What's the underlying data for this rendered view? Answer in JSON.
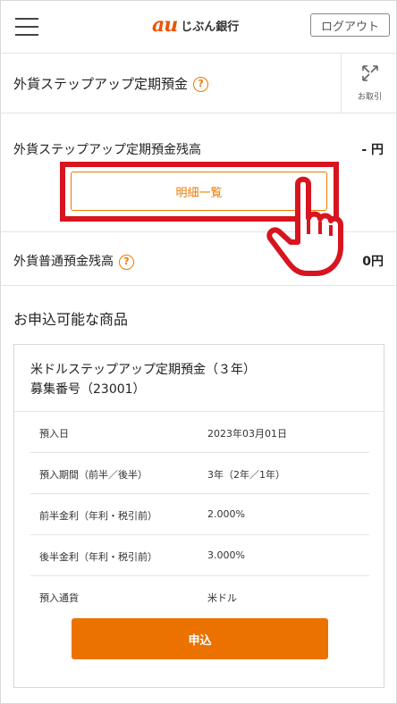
{
  "header": {
    "logo_mark": "au",
    "logo_text": "じぶん銀行",
    "logout_label": "ログアウト",
    "brand_color": "#eb5505"
  },
  "account": {
    "title": "外貨ステップアップ定期預金",
    "transaction_label": "お取引"
  },
  "step_balance": {
    "label": "外貨ステップアップ定期預金残高",
    "value": "- 円",
    "detail_button_label": "明細一覧"
  },
  "ordinary_balance": {
    "label": "外貨普通預金残高",
    "value": "0円"
  },
  "products": {
    "section_title": "お申込可能な商品",
    "card": {
      "title_line1": "米ドルステップアップ定期預金（３年）",
      "title_line2": "募集番号（23001）",
      "rows": [
        {
          "key": "預入日",
          "value": "2023年03月01日"
        },
        {
          "key": "預入期間（前半／後半）",
          "value": "3年（2年／1年）"
        },
        {
          "key": "前半金利（年利・税引前）",
          "value": "2.000%"
        },
        {
          "key": "後半金利（年利・税引前）",
          "value": "3.000%"
        },
        {
          "key": "預入通貨",
          "value": "米ドル"
        }
      ],
      "apply_label": "申込"
    }
  },
  "colors": {
    "accent": "#eb7a00",
    "highlight": "#d7141f",
    "apply_button": "#ec7200"
  }
}
